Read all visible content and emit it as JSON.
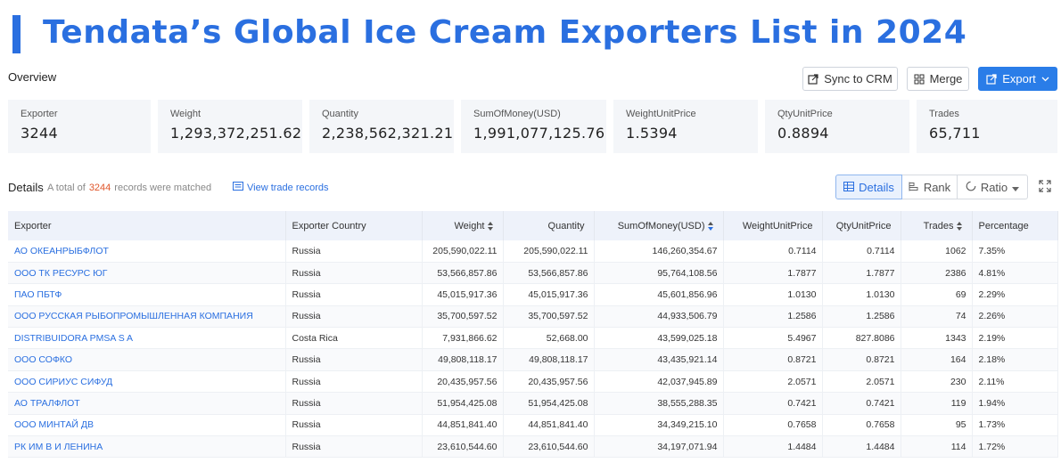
{
  "title": "Tendata’s Global Ice Cream Exporters List in 2024",
  "overview": {
    "label": "Overview",
    "buttons": {
      "sync": "Sync to CRM",
      "merge": "Merge",
      "export": "Export"
    },
    "stats": [
      {
        "label": "Exporter",
        "value": "3244"
      },
      {
        "label": "Weight",
        "value": "1,293,372,251.62"
      },
      {
        "label": "Quantity",
        "value": "2,238,562,321.21"
      },
      {
        "label": "SumOfMoney(USD)",
        "value": "1,991,077,125.76"
      },
      {
        "label": "WeightUnitPrice",
        "value": "1.5394"
      },
      {
        "label": "QtyUnitPrice",
        "value": "0.8894"
      },
      {
        "label": "Trades",
        "value": "65,711"
      }
    ]
  },
  "details": {
    "label": "Details",
    "matched_prefix": "A total of",
    "matched_count": "3244",
    "matched_suffix": "records were matched",
    "view_trade": "View trade records",
    "views": {
      "details": "Details",
      "rank": "Rank",
      "ratio": "Ratio"
    }
  },
  "table": {
    "columns": [
      "Exporter",
      "Exporter Country",
      "Weight",
      "Quantity",
      "SumOfMoney(USD)",
      "WeightUnitPrice",
      "QtyUnitPrice",
      "Trades",
      "Percentage"
    ],
    "rows": [
      [
        "АО ОКЕАНРЫБФЛОТ",
        "Russia",
        "205,590,022.11",
        "205,590,022.11",
        "146,260,354.67",
        "0.7114",
        "0.7114",
        "1062",
        "7.35%"
      ],
      [
        "ООО ТК РЕСУРС ЮГ",
        "Russia",
        "53,566,857.86",
        "53,566,857.86",
        "95,764,108.56",
        "1.7877",
        "1.7877",
        "2386",
        "4.81%"
      ],
      [
        "ПАО ПБТФ",
        "Russia",
        "45,015,917.36",
        "45,015,917.36",
        "45,601,856.96",
        "1.0130",
        "1.0130",
        "69",
        "2.29%"
      ],
      [
        "ООО РУССКАЯ РЫБОПРОМЫШЛЕННАЯ КОМПАНИЯ",
        "Russia",
        "35,700,597.52",
        "35,700,597.52",
        "44,933,506.79",
        "1.2586",
        "1.2586",
        "74",
        "2.26%"
      ],
      [
        "DISTRIBUIDORA PMSA S A",
        "Costa Rica",
        "7,931,866.62",
        "52,668.00",
        "43,599,025.18",
        "5.4967",
        "827.8086",
        "1343",
        "2.19%"
      ],
      [
        "ООО СОФКО",
        "Russia",
        "49,808,118.17",
        "49,808,118.17",
        "43,435,921.14",
        "0.8721",
        "0.8721",
        "164",
        "2.18%"
      ],
      [
        "ООО СИРИУС СИФУД",
        "Russia",
        "20,435,957.56",
        "20,435,957.56",
        "42,037,945.89",
        "2.0571",
        "2.0571",
        "230",
        "2.11%"
      ],
      [
        "АО ТРАЛФЛОТ",
        "Russia",
        "51,954,425.08",
        "51,954,425.08",
        "38,555,288.35",
        "0.7421",
        "0.7421",
        "119",
        "1.94%"
      ],
      [
        "ООО МИНТАЙ ДВ",
        "Russia",
        "44,851,841.40",
        "44,851,841.40",
        "34,349,215.10",
        "0.7658",
        "0.7658",
        "95",
        "1.73%"
      ],
      [
        "РК ИМ В И ЛЕНИНА",
        "Russia",
        "23,610,544.60",
        "23,610,544.60",
        "34,197,071.94",
        "1.4484",
        "1.4484",
        "114",
        "1.72%"
      ]
    ]
  }
}
